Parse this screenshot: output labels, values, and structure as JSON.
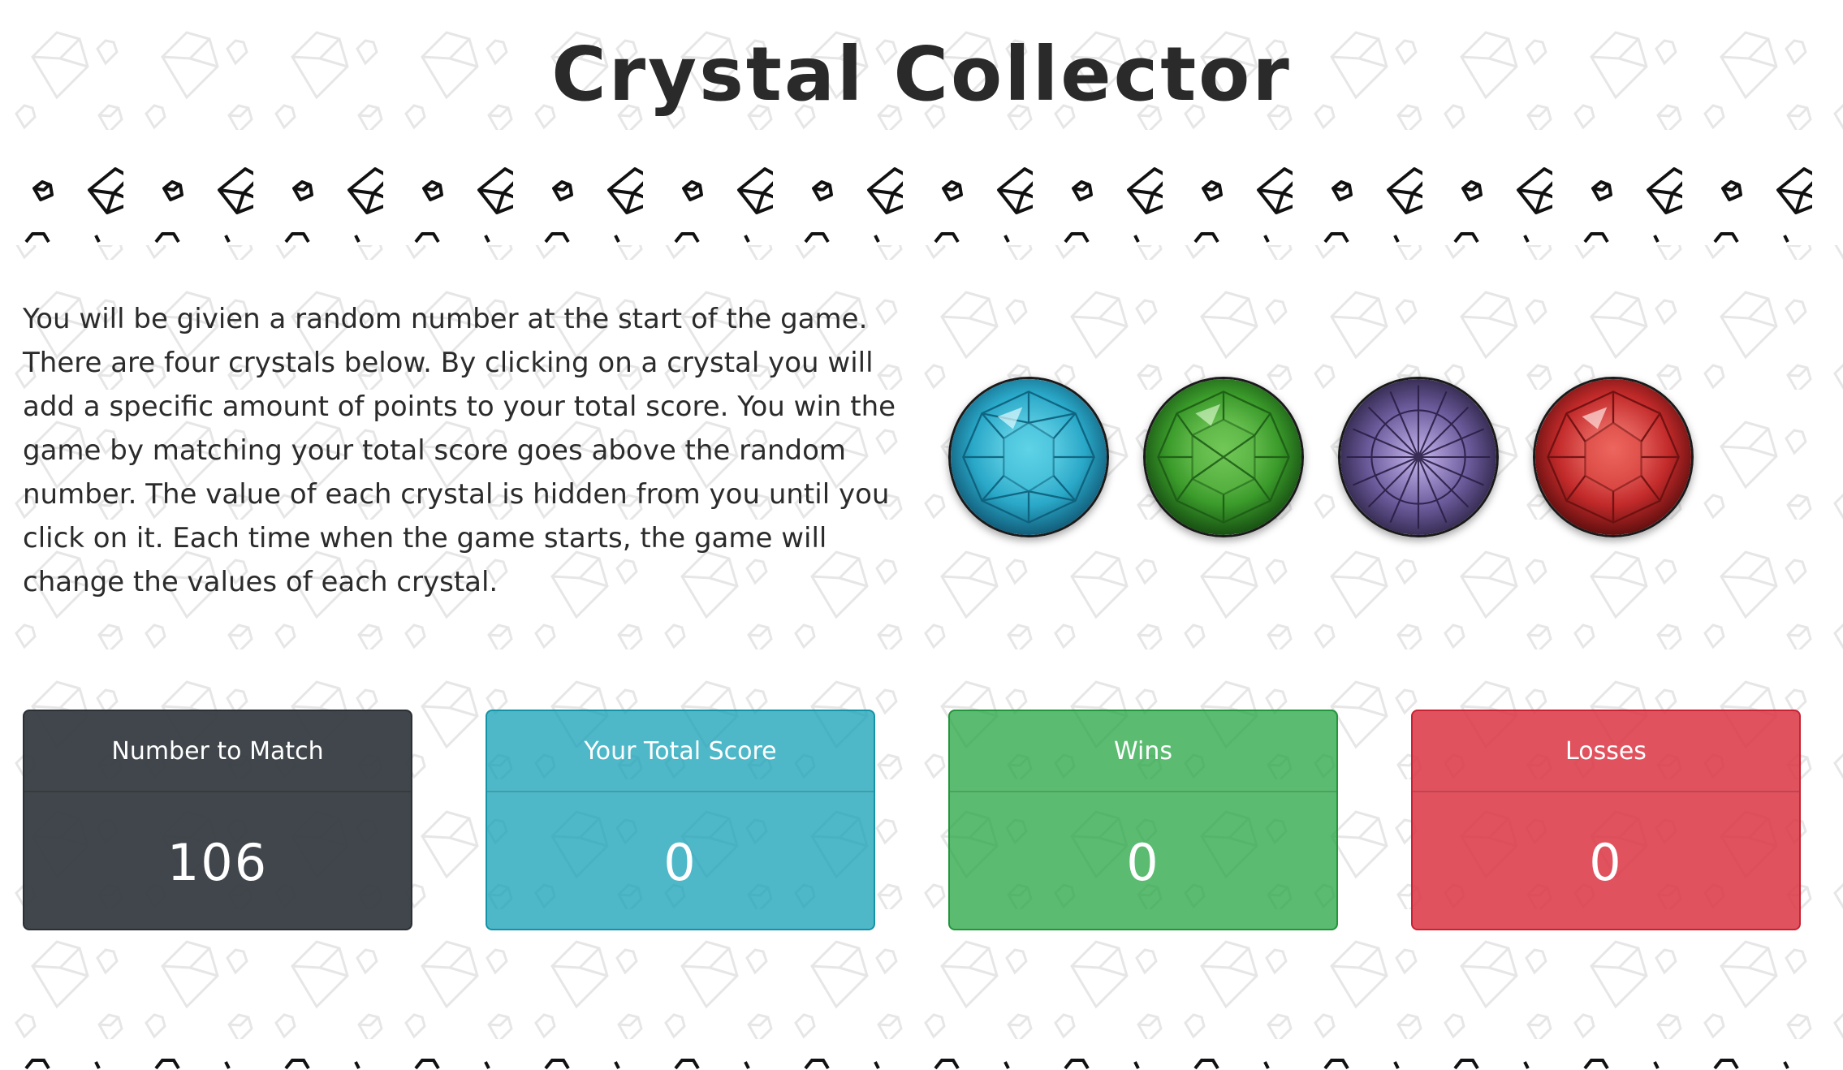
{
  "title": "Crystal Collector",
  "instructions": "You will be givien a random number at the start of the game. There are four crystals below. By clicking on a crystal you will add a specific amount of points to your total score. You win the game by matching your total score goes above the random number. The value of each crystal is hidden from you until you click on it. Each time when the game starts, the game will change the values of each crystal.",
  "crystals": [
    {
      "name": "blue-crystal",
      "color": "#2aa8c8"
    },
    {
      "name": "green-crystal",
      "color": "#3a9a2a"
    },
    {
      "name": "purple-crystal",
      "color": "#6a5a9a"
    },
    {
      "name": "red-crystal",
      "color": "#c22a2a"
    }
  ],
  "stats": {
    "match": {
      "label": "Number to Match",
      "value": "106",
      "color": "#343a40"
    },
    "score": {
      "label": "Your Total Score",
      "value": "0",
      "color": "#17a2b8"
    },
    "wins": {
      "label": "Wins",
      "value": "0",
      "color": "#28a745"
    },
    "losses": {
      "label": "Losses",
      "value": "0",
      "color": "#dc3545"
    }
  }
}
